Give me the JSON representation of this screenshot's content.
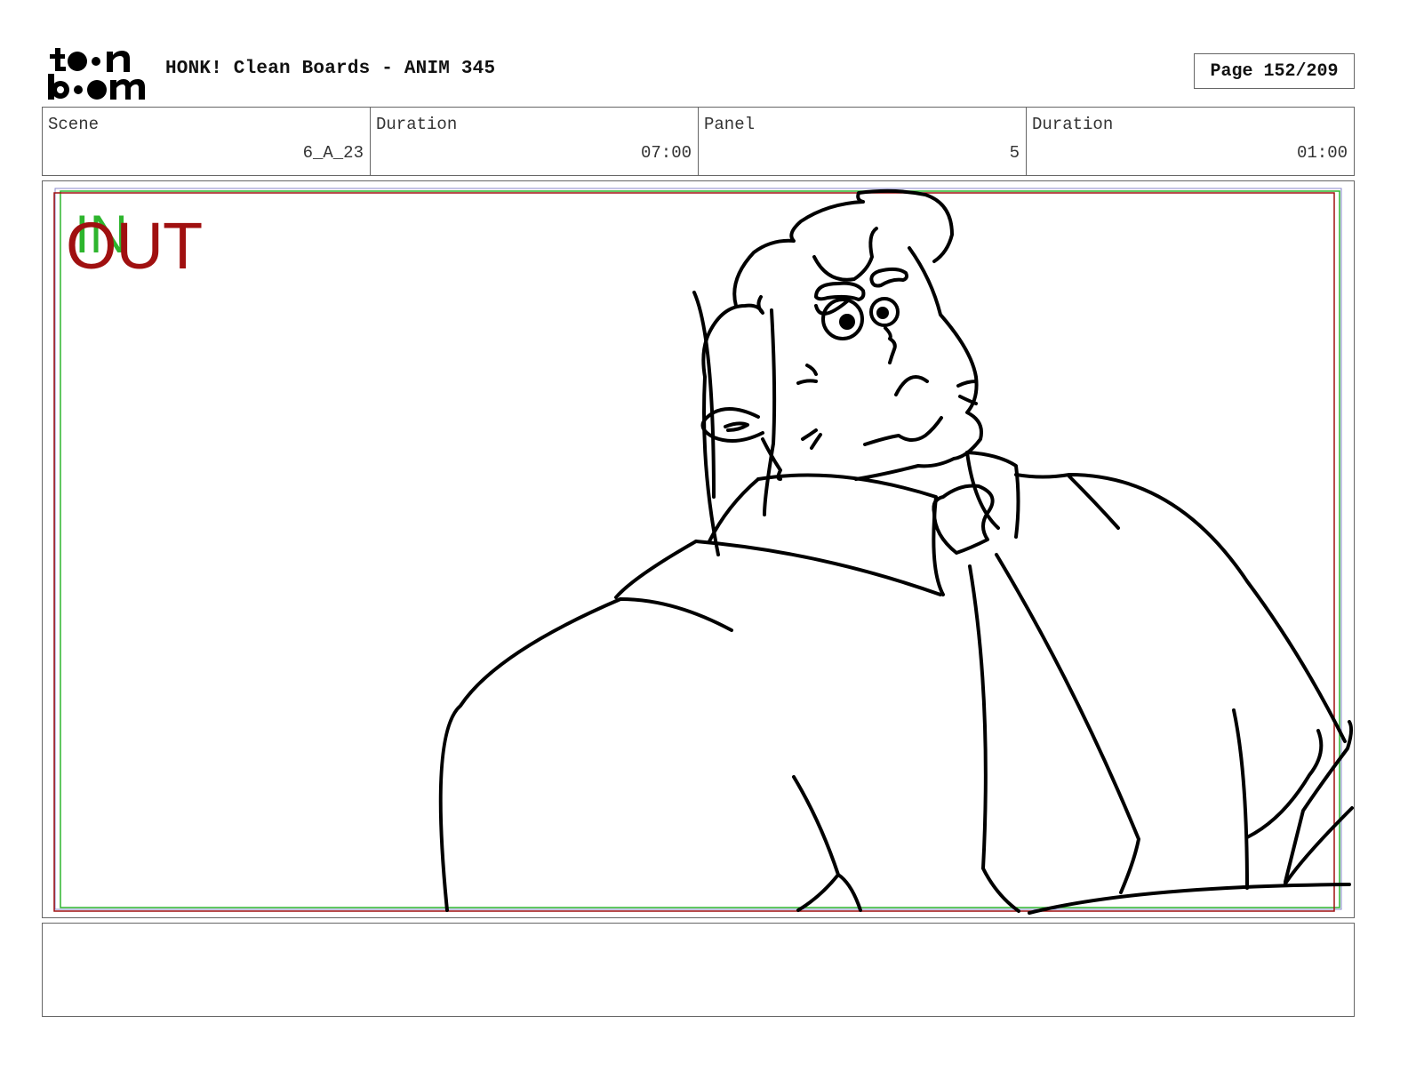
{
  "header": {
    "logo_text": "toon boom",
    "title": "HONK! Clean Boards - ANIM 345",
    "page_label": "Page 152/209"
  },
  "info": {
    "scene_label": "Scene",
    "scene_value": "6_A_23",
    "scene_duration_label": "Duration",
    "scene_duration_value": "07:00",
    "panel_label": "Panel",
    "panel_value": "5",
    "panel_duration_label": "Duration",
    "panel_duration_value": "01:00"
  },
  "panel": {
    "in_marker": "IN",
    "out_marker": "OUT",
    "colors": {
      "in": "#2db52d",
      "out": "#a01010",
      "line": "#000000"
    }
  },
  "notes": {
    "text": ""
  }
}
